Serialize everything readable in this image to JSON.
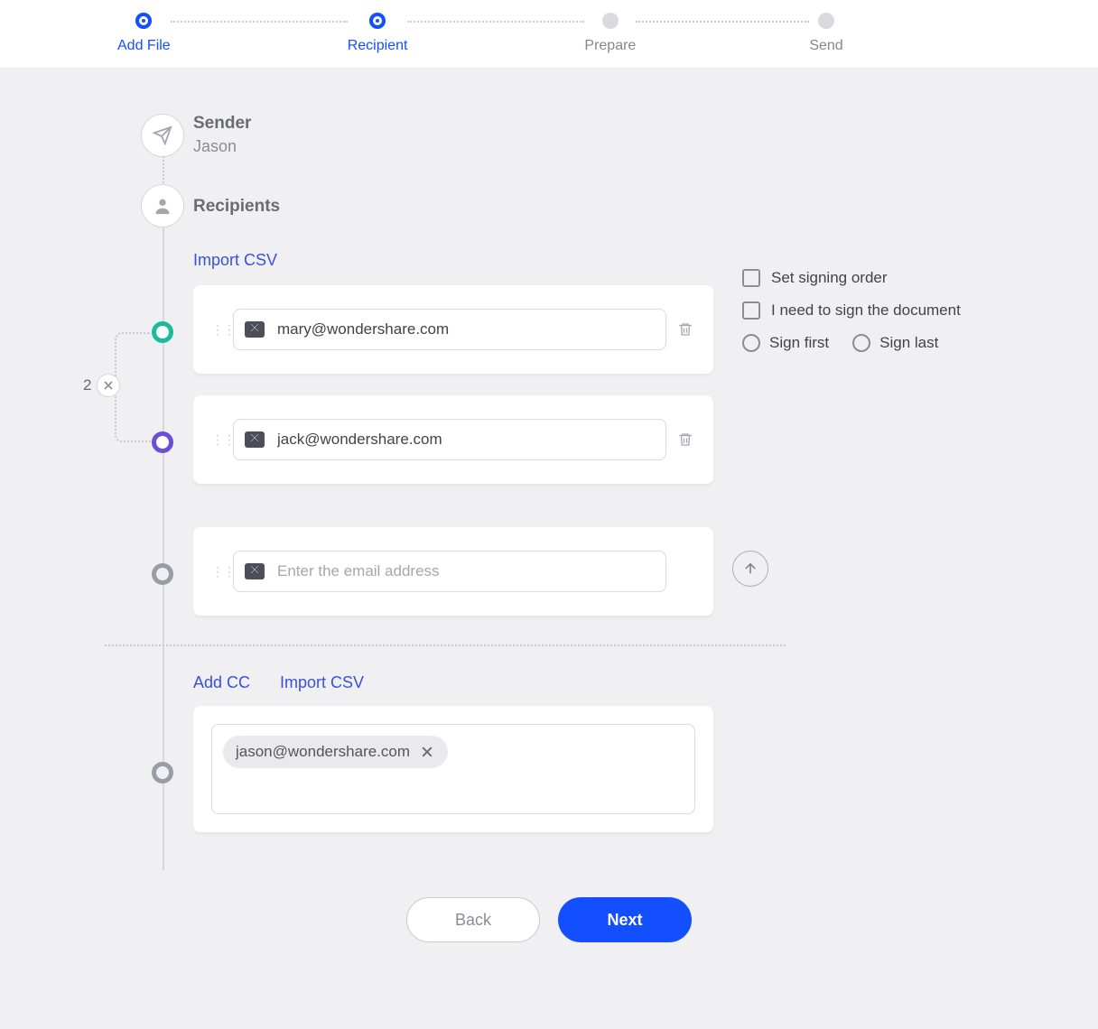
{
  "stepper": {
    "steps": [
      {
        "label": "Add File",
        "active": true
      },
      {
        "label": "Recipient",
        "active": true
      },
      {
        "label": "Prepare",
        "active": false
      },
      {
        "label": "Send",
        "active": false
      }
    ]
  },
  "sender": {
    "heading": "Sender",
    "name": "Jason"
  },
  "recipients": {
    "heading": "Recipients",
    "import_csv_label": "Import CSV",
    "count": "2",
    "rows": [
      {
        "email": "mary@wondershare.com"
      },
      {
        "email": "jack@wondershare.com"
      }
    ],
    "empty_placeholder": "Enter the email address"
  },
  "options": {
    "set_signing_order": "Set signing order",
    "i_need_to_sign": "I need to sign the document",
    "sign_first": "Sign first",
    "sign_last": "Sign last"
  },
  "cc": {
    "add_cc_label": "Add CC",
    "import_csv_label": "Import CSV",
    "chips": [
      {
        "email": "jason@wondershare.com"
      }
    ]
  },
  "footer": {
    "back": "Back",
    "next": "Next"
  }
}
